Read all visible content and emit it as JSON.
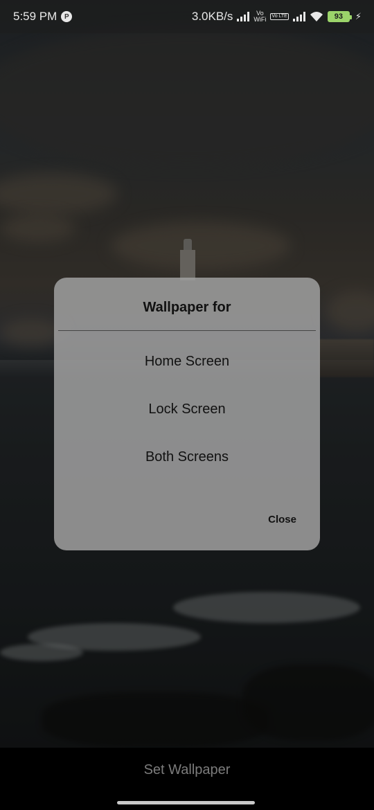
{
  "status_bar": {
    "time": "5:59 PM",
    "notification_icon_glyph": "P",
    "net_speed": "3.0KB/s",
    "vowifi_top": "Vo",
    "vowifi_bottom": "WiFi",
    "volte_label": "Vo LTE",
    "battery_level": "93",
    "charging_glyph": "⚡"
  },
  "dialog": {
    "title": "Wallpaper for",
    "options": [
      "Home Screen",
      "Lock Screen",
      "Both Screens"
    ],
    "close_label": "Close"
  },
  "bottom": {
    "set_wallpaper_label": "Set Wallpaper"
  },
  "icons": {
    "status_notification": "app-notification-icon",
    "signal_1": "cellular-signal-icon",
    "vowifi": "vowifi-icon",
    "volte": "volte-icon",
    "signal_2": "cellular-signal-icon",
    "wifi": "wifi-icon",
    "battery": "battery-icon",
    "charging": "charging-icon"
  },
  "colors": {
    "battery": "#9bd46a",
    "dialog_bg": "#a0a0a0",
    "bottom_bar": "#000000"
  }
}
